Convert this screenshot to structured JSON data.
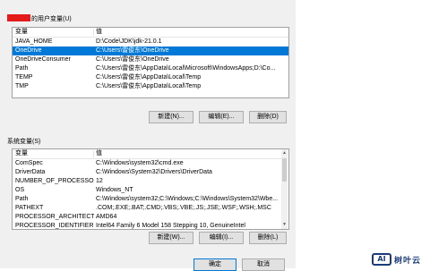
{
  "user_section": {
    "title_suffix": "的用户变量(U)",
    "col_variable": "变量",
    "col_value": "值",
    "rows": [
      {
        "name": "JAVA_HOME",
        "value": "D:\\Code\\JDK\\jdk-21.0.1"
      },
      {
        "name": "OneDrive",
        "value": "C:\\Users\\雷俊东\\OneDrive"
      },
      {
        "name": "OneDriveConsumer",
        "value": "C:\\Users\\雷俊东\\OneDrive"
      },
      {
        "name": "Path",
        "value": "C:\\Users\\雷俊东\\AppData\\Local\\Microsoft\\WindowsApps;D:\\Co..."
      },
      {
        "name": "TEMP",
        "value": "C:\\Users\\雷俊东\\AppData\\Local\\Temp"
      },
      {
        "name": "TMP",
        "value": "C:\\Users\\雷俊东\\AppData\\Local\\Temp"
      }
    ],
    "selected_index": 1,
    "buttons": {
      "new": "新建(N)...",
      "edit": "编辑(E)...",
      "delete": "删除(D)"
    }
  },
  "system_section": {
    "title": "系统变量(S)",
    "col_variable": "变量",
    "col_value": "值",
    "rows": [
      {
        "name": "ComSpec",
        "value": "C:\\Windows\\system32\\cmd.exe"
      },
      {
        "name": "DriverData",
        "value": "C:\\Windows\\System32\\Drivers\\DriverData"
      },
      {
        "name": "NUMBER_OF_PROCESSORS",
        "value": "12"
      },
      {
        "name": "OS",
        "value": "Windows_NT"
      },
      {
        "name": "Path",
        "value": "C:\\Windows\\system32;C:\\Windows;C:\\Windows\\System32\\Wbe..."
      },
      {
        "name": "PATHEXT",
        "value": ".COM;.EXE;.BAT;.CMD;.VBS;.VBE;.JS;.JSE;.WSF;.WSH;.MSC"
      },
      {
        "name": "PROCESSOR_ARCHITECTURE",
        "value": "AMD64"
      },
      {
        "name": "PROCESSOR_IDENTIFIER",
        "value": "Intel64 Family 6 Model 158 Stepping 10, GenuineIntel"
      }
    ],
    "buttons": {
      "new": "新建(W)...",
      "edit": "编辑(I)...",
      "delete": "删除(L)"
    }
  },
  "footer": {
    "ok": "确定",
    "cancel": "取消"
  },
  "watermark": {
    "logo": "AI",
    "text": "树叶云"
  },
  "colors": {
    "selection": "#0078d7",
    "redaction": "#e41b1b"
  }
}
